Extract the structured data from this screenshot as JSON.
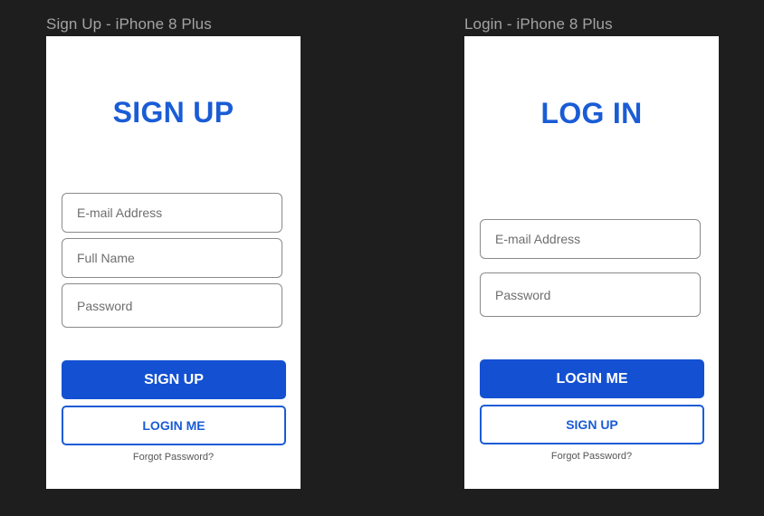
{
  "frames": {
    "signup": {
      "label": "Sign Up - iPhone 8 Plus",
      "title": "SIGN UP",
      "fields": {
        "email_placeholder": "E-mail Address",
        "fullname_placeholder": "Full Name",
        "password_placeholder": "Password"
      },
      "primary_button": "SIGN UP",
      "secondary_button": "LOGIN ME",
      "forgot": "Forgot Password?"
    },
    "login": {
      "label": "Login - iPhone 8 Plus",
      "title": "LOG IN",
      "fields": {
        "email_placeholder": "E-mail Address",
        "password_placeholder": "Password"
      },
      "primary_button": "LOGIN ME",
      "secondary_button": "SIGN UP",
      "forgot": "Forgot Password?"
    }
  },
  "colors": {
    "canvas": "#1e1e1e",
    "accent": "#1a5cd6",
    "primary_button": "#1450d2",
    "frame_label": "#a3a3a3"
  }
}
